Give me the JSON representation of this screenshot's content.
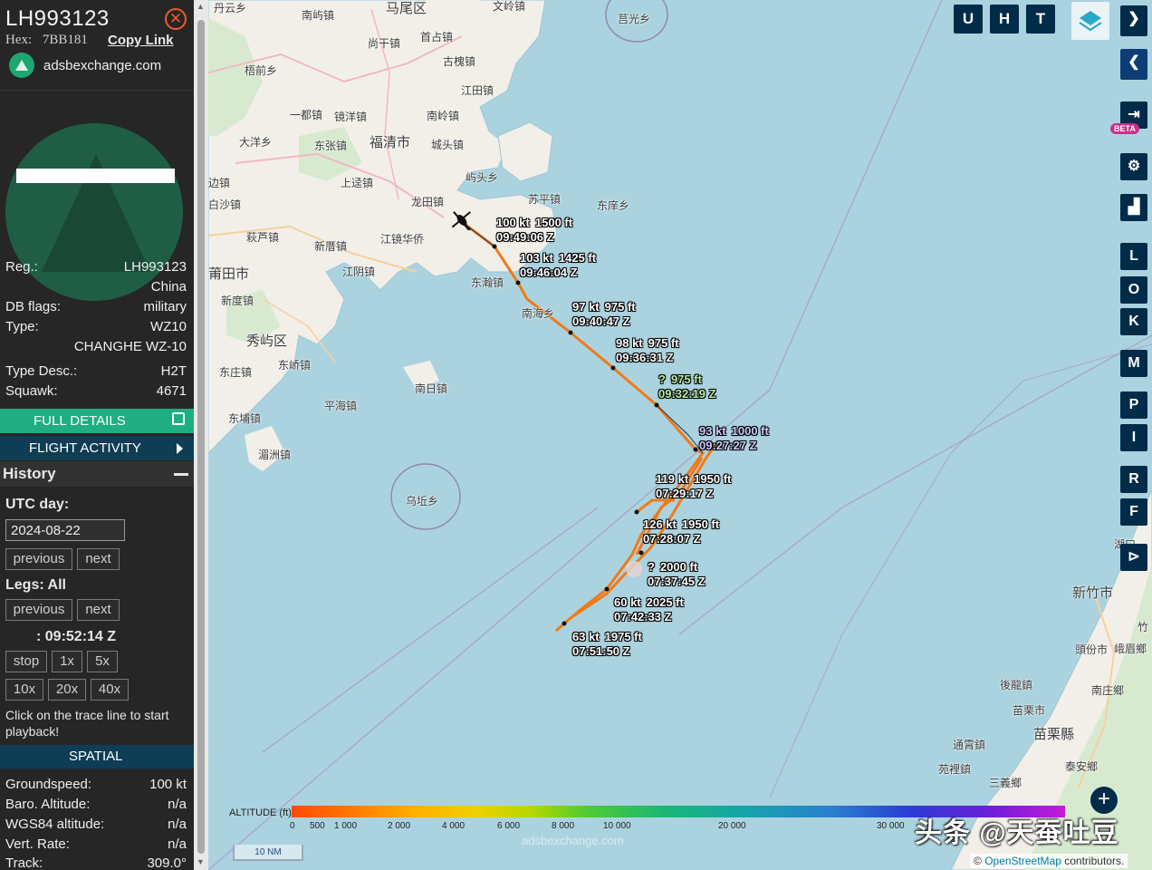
{
  "aircraft": {
    "callsign": "LH993123",
    "hex_label": "Hex:",
    "hex": "7BB181",
    "copy_link": "Copy Link",
    "site": "adsbexchange.com"
  },
  "details": {
    "reg_label": "Reg.:",
    "reg": "LH993123",
    "country": "China",
    "dbflags_label": "DB flags:",
    "dbflags": "military",
    "type_label": "Type:",
    "type": "WZ10",
    "type_full": "CHANGHE WZ-10",
    "typedesc_label": "Type Desc.:",
    "typedesc": "H2T",
    "squawk_label": "Squawk:",
    "squawk": "4671"
  },
  "buttons": {
    "full_details": "FULL DETAILS",
    "flight_activity": "FLIGHT ACTIVITY"
  },
  "history": {
    "title": "History",
    "utc_day_label": "UTC day:",
    "date": "2024-08-22",
    "prev": "previous",
    "next": "next",
    "legs_label": "Legs: All",
    "prev2": "previous",
    "next2": "next",
    "time": ": 09:52:14 Z",
    "stop": "stop",
    "x1": "1x",
    "x5": "5x",
    "x10": "10x",
    "x20": "20x",
    "x40": "40x",
    "help": "Click on the trace line to start playback!"
  },
  "spatial": {
    "title": "SPATIAL",
    "gs_label": "Groundspeed:",
    "gs": "100 kt",
    "baro_label": "Baro. Altitude:",
    "baro": "n/a",
    "wgs_label": "WGS84 altitude:",
    "wgs": "n/a",
    "vr_label": "Vert. Rate:",
    "vr": "n/a",
    "track_label": "Track:",
    "track": "309.0°"
  },
  "map_buttons": {
    "u": "U",
    "h": "H",
    "t": "T",
    "beta": "BETA",
    "l": "L",
    "o": "O",
    "k": "K",
    "m": "M",
    "p": "P",
    "i": "I",
    "r": "R",
    "f": "F"
  },
  "trace_labels": [
    {
      "speed": "100 kt",
      "alt": "1500 ft",
      "time": "09:49:06 Z"
    },
    {
      "speed": "103 kt",
      "alt": "1425 ft",
      "time": "09:46:04 Z"
    },
    {
      "speed": "97 kt",
      "alt": "975 ft",
      "time": "09:40:47 Z"
    },
    {
      "speed": "98 kt",
      "alt": "975 ft",
      "time": "09:36:31 Z"
    },
    {
      "speed": "?",
      "alt": "975 ft",
      "time": "09:32:19 Z"
    },
    {
      "speed": "93 kt",
      "alt": "1000 ft",
      "time": "09:27:27 Z"
    },
    {
      "speed": "119 kt",
      "alt": "1950 ft",
      "time": "07:29:17 Z"
    },
    {
      "speed": "126 kt",
      "alt": "1950 ft",
      "time": "07:28:07 Z"
    },
    {
      "speed": "?",
      "alt": "2000 ft",
      "time": "07:37:45 Z"
    },
    {
      "speed": "60 kt",
      "alt": "2025 ft",
      "time": "07:42:33 Z"
    },
    {
      "speed": "63 kt",
      "alt": "1975 ft",
      "time": "07:51:50 Z"
    }
  ],
  "places": [
    "丹云乡",
    "南屿镇",
    "马尾区",
    "文岭镇",
    "莒光乡",
    "尚干镇",
    "首占镇",
    "古槐镇",
    "梧前乡",
    "江田镇",
    "一都镇",
    "镜洋镇",
    "南岭镇",
    "大洋乡",
    "东张镇",
    "福清市",
    "城头镇",
    "屿头乡",
    "上迳镇",
    "边镇",
    "白沙镇",
    "龙田镇",
    "苏平镇",
    "东庠乡",
    "萩芦镇",
    "新厝镇",
    "江镜华侨",
    "莆田市",
    "江阴镇",
    "东瀚镇",
    "新度镇",
    "南海乡",
    "秀屿区",
    "东峤镇",
    "东庄镇",
    "南日镇",
    "平海镇",
    "东埔镇",
    "湄洲镇",
    "乌坵乡",
    "新竹市",
    "竹",
    "頭份市",
    "峨眉鄉",
    "後龍鎮",
    "南庄鄉",
    "苗栗市",
    "苗栗縣",
    "通霄鎮",
    "泰安鄉",
    "苑裡鎮",
    "三義鄉",
    "湖口"
  ],
  "legend": {
    "title": "ALTITUDE (ft)",
    "ticks": [
      "0",
      "500",
      "1 000",
      "2 000",
      "4 000",
      "6 000",
      "8 000",
      "10 000",
      "20 000",
      "30 000"
    ],
    "scale": "10 NM"
  },
  "attribution": {
    "prefix": "©",
    "link": "OpenStreetMap",
    "suffix": "contributors."
  },
  "watermark": "头条 @天蚕吐豆",
  "wm_logo": "adsbexchange.com"
}
